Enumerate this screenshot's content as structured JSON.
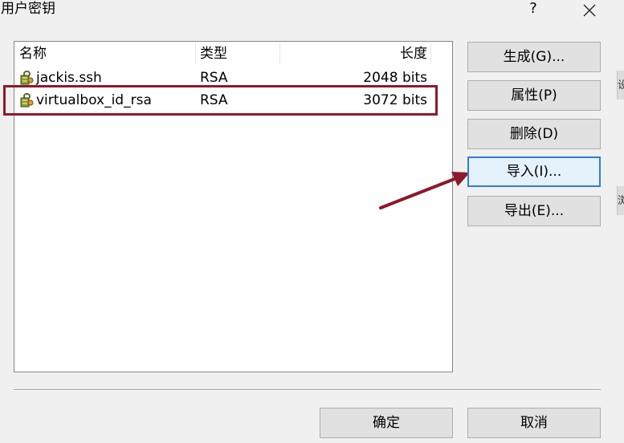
{
  "window": {
    "title": "用户密钥",
    "help_label": "?",
    "close_icon": "close-icon"
  },
  "side_edge": {
    "text_1": "设",
    "text_2": "浏"
  },
  "key_list": {
    "columns": [
      "名称",
      "类型",
      "长度"
    ],
    "rows": [
      {
        "name": "jackis.ssh",
        "type": "RSA",
        "length": "2048 bits",
        "icon": "key-icon"
      },
      {
        "name": "virtualbox_id_rsa",
        "type": "RSA",
        "length": "3072 bits",
        "icon": "key-icon"
      }
    ]
  },
  "buttons": {
    "generate": "生成(G)...",
    "properties": "属性(P)",
    "delete": "删除(D)",
    "import": "导入(I)...",
    "export": "导出(E)...",
    "ok": "确定",
    "cancel": "取消"
  },
  "annotation": {
    "highlight_color": "#8b1a2b",
    "arrow_color": "#8b1a2b"
  },
  "colors": {
    "focus_border": "#2f7dd4",
    "button_face": "#e1e1e1",
    "dialog_background": "#f0f0f0"
  }
}
